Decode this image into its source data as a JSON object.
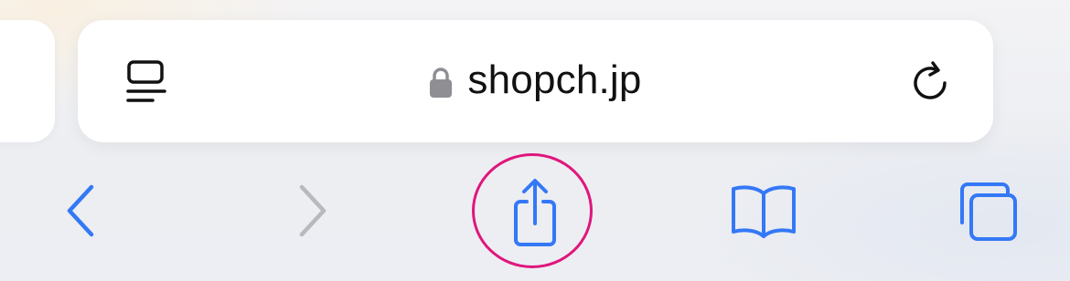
{
  "address_bar": {
    "url": "shopch.jp",
    "page_menu_icon": "page-menu-icon",
    "lock_icon": "lock-icon",
    "reload_icon": "reload-icon"
  },
  "toolbar": {
    "back_icon": "chevron-left-icon",
    "forward_icon": "chevron-right-icon",
    "share_icon": "share-icon",
    "bookmarks_icon": "book-icon",
    "tabs_icon": "tabs-icon"
  },
  "colors": {
    "accent": "#3478f6",
    "disabled": "#b8b9bd",
    "text": "#111111",
    "lock": "#8e8e93",
    "highlight": "#e0167c",
    "card": "#ffffff"
  }
}
